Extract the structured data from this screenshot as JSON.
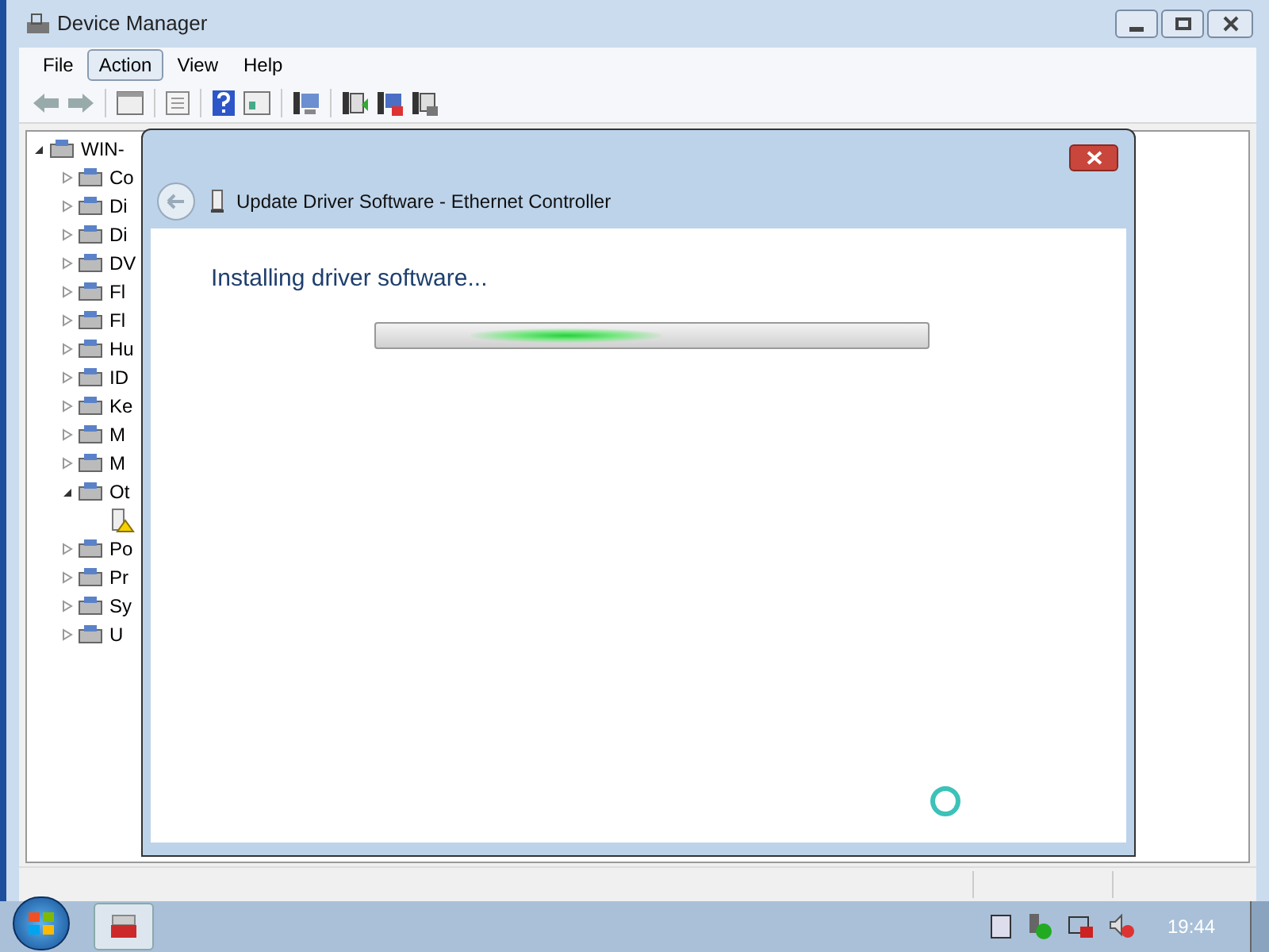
{
  "window": {
    "title": "Device Manager"
  },
  "menu": [
    {
      "label": "File",
      "selected": false
    },
    {
      "label": "Action",
      "selected": true
    },
    {
      "label": "View",
      "selected": false
    },
    {
      "label": "Help",
      "selected": false
    }
  ],
  "tree": {
    "label": "WIN-",
    "expanded": true,
    "children": [
      {
        "label": "Co",
        "expanded": false
      },
      {
        "label": "Di",
        "expanded": false
      },
      {
        "label": "Di",
        "expanded": false
      },
      {
        "label": "DV",
        "expanded": false
      },
      {
        "label": "Fl",
        "expanded": false
      },
      {
        "label": "Fl",
        "expanded": false
      },
      {
        "label": "Hu",
        "expanded": false
      },
      {
        "label": "ID",
        "expanded": false
      },
      {
        "label": "Ke",
        "expanded": false
      },
      {
        "label": "M",
        "expanded": false
      },
      {
        "label": "M",
        "expanded": false
      },
      {
        "label": "Ot",
        "expanded": true,
        "children": [
          {
            "kind": "warning"
          }
        ]
      },
      {
        "label": "Po",
        "expanded": false
      },
      {
        "label": "Pr",
        "expanded": false
      },
      {
        "label": "Sy",
        "expanded": false
      },
      {
        "label": "U",
        "expanded": false
      }
    ]
  },
  "dialog": {
    "title": "Update Driver Software - Ethernet Controller",
    "heading": "Installing driver software...",
    "progress": {
      "indeterminate": true
    }
  },
  "taskbar": {
    "clock": "19:44"
  }
}
